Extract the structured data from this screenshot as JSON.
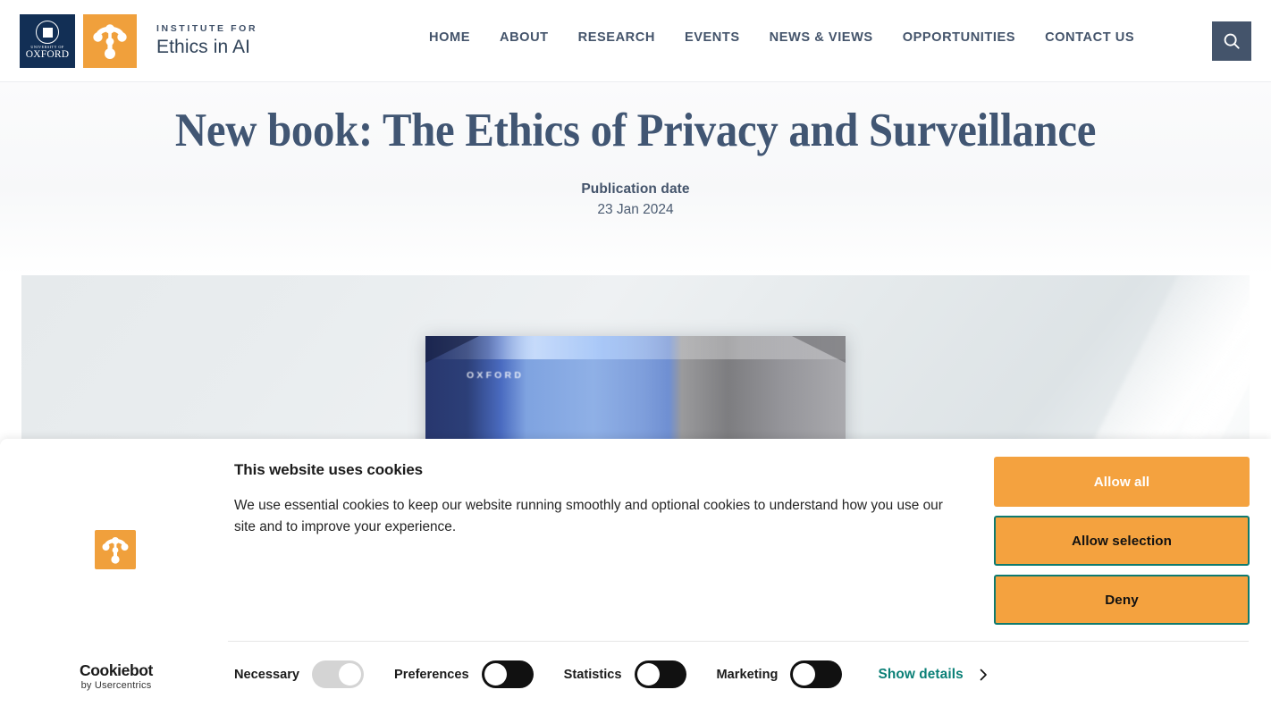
{
  "header": {
    "oxford_logo": {
      "line1": "UNIVERSITY OF",
      "line2": "OXFORD",
      "icon": "oxford-crest-icon",
      "bg": "#122f55"
    },
    "institute_logo": {
      "icon": "ethics-in-ai-node-icon",
      "bg": "#f0a03c"
    },
    "brand": {
      "kicker": "INSTITUTE FOR",
      "name": "Ethics in AI"
    },
    "nav": [
      {
        "label": "HOME"
      },
      {
        "label": "ABOUT"
      },
      {
        "label": "RESEARCH"
      },
      {
        "label": "EVENTS"
      },
      {
        "label": "NEWS & VIEWS"
      },
      {
        "label": "OPPORTUNITIES"
      },
      {
        "label": "CONTACT US"
      }
    ],
    "search": {
      "icon": "search-icon",
      "bg": "#44546b"
    },
    "nav_color": "#44546b"
  },
  "page": {
    "title": "New book: The Ethics of Privacy and Surveillance",
    "title_color": "#415673",
    "publication_label": "Publication date",
    "publication_date": "23 Jan 2024"
  },
  "hero": {
    "book_cover_text": "OXFORD",
    "alt": "book-cover-image"
  },
  "cookie_banner": {
    "title": "This website uses cookies",
    "body": "We use essential cookies to keep our website running smoothly and optional cookies to understand how you use our site and to improve your experience.",
    "logo_icon": "ethics-in-ai-node-icon",
    "buttons": [
      {
        "label": "Allow all",
        "style": "primary"
      },
      {
        "label": "Allow selection",
        "style": "outlined"
      },
      {
        "label": "Deny",
        "style": "outlined"
      }
    ],
    "accent_color": "#f4a23f",
    "outline_color": "#0f7a6e",
    "toggles": [
      {
        "label": "Necessary",
        "state": "on-locked"
      },
      {
        "label": "Preferences",
        "state": "off"
      },
      {
        "label": "Statistics",
        "state": "off"
      },
      {
        "label": "Marketing",
        "state": "off"
      }
    ],
    "show_details": {
      "label": "Show details",
      "icon": "chevron-right-icon",
      "color": "#0b8077"
    },
    "brand": {
      "name": "Cookiebot",
      "subtitle": "by Usercentrics"
    }
  }
}
